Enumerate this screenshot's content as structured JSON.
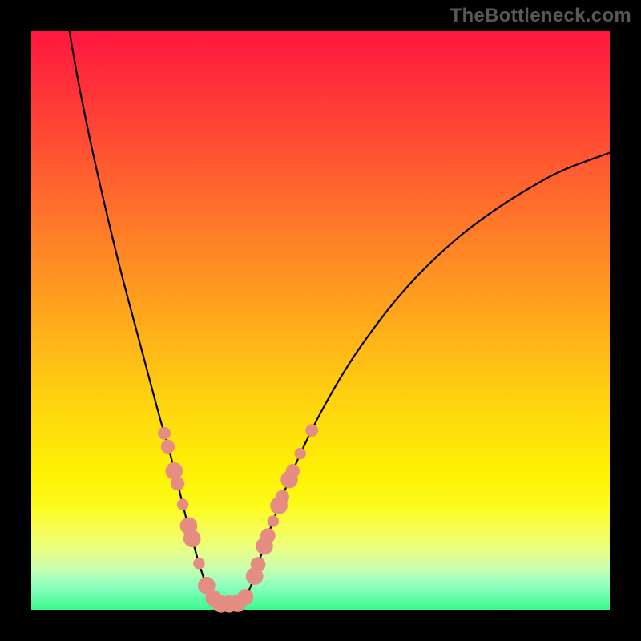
{
  "watermark": "TheBottleneck.com",
  "chart_data": {
    "type": "line",
    "title": "",
    "xlabel": "",
    "ylabel": "",
    "xlim": [
      0,
      100
    ],
    "ylim": [
      0,
      100
    ],
    "grid": false,
    "legend": false,
    "curve": [
      {
        "x": 6.6,
        "y": 100.0
      },
      {
        "x": 8.0,
        "y": 92.0
      },
      {
        "x": 10.0,
        "y": 82.0
      },
      {
        "x": 12.0,
        "y": 73.0
      },
      {
        "x": 14.0,
        "y": 64.5
      },
      {
        "x": 16.0,
        "y": 56.5
      },
      {
        "x": 18.0,
        "y": 49.0
      },
      {
        "x": 20.0,
        "y": 41.5
      },
      {
        "x": 22.0,
        "y": 34.0
      },
      {
        "x": 23.0,
        "y": 30.5
      },
      {
        "x": 24.0,
        "y": 27.0
      },
      {
        "x": 25.0,
        "y": 23.0
      },
      {
        "x": 26.0,
        "y": 19.0
      },
      {
        "x": 27.0,
        "y": 15.0
      },
      {
        "x": 28.0,
        "y": 11.5
      },
      {
        "x": 29.0,
        "y": 8.0
      },
      {
        "x": 30.0,
        "y": 5.0
      },
      {
        "x": 31.0,
        "y": 3.0
      },
      {
        "x": 32.0,
        "y": 1.5
      },
      {
        "x": 33.0,
        "y": 1.0
      },
      {
        "x": 34.0,
        "y": 1.0
      },
      {
        "x": 35.0,
        "y": 1.0
      },
      {
        "x": 36.0,
        "y": 1.2
      },
      {
        "x": 37.0,
        "y": 2.2
      },
      {
        "x": 38.0,
        "y": 4.2
      },
      {
        "x": 39.0,
        "y": 7.2
      },
      {
        "x": 40.0,
        "y": 10.2
      },
      {
        "x": 41.5,
        "y": 14.5
      },
      {
        "x": 43.0,
        "y": 18.5
      },
      {
        "x": 45.0,
        "y": 23.5
      },
      {
        "x": 47.0,
        "y": 28.0
      },
      {
        "x": 50.0,
        "y": 34.0
      },
      {
        "x": 54.0,
        "y": 41.0
      },
      {
        "x": 58.0,
        "y": 47.0
      },
      {
        "x": 63.0,
        "y": 53.5
      },
      {
        "x": 68.0,
        "y": 59.0
      },
      {
        "x": 74.0,
        "y": 64.5
      },
      {
        "x": 80.0,
        "y": 69.0
      },
      {
        "x": 86.0,
        "y": 72.8
      },
      {
        "x": 92.0,
        "y": 76.0
      },
      {
        "x": 100.0,
        "y": 79.0
      }
    ],
    "markers": [
      {
        "x": 23.0,
        "y": 30.5,
        "r": 1.1
      },
      {
        "x": 23.6,
        "y": 28.2,
        "r": 1.2
      },
      {
        "x": 24.7,
        "y": 24.0,
        "r": 1.5
      },
      {
        "x": 25.3,
        "y": 21.8,
        "r": 1.2
      },
      {
        "x": 26.2,
        "y": 18.2,
        "r": 1.0
      },
      {
        "x": 27.2,
        "y": 14.5,
        "r": 1.5
      },
      {
        "x": 27.8,
        "y": 12.3,
        "r": 1.5
      },
      {
        "x": 29.0,
        "y": 8.0,
        "r": 1.0
      },
      {
        "x": 30.3,
        "y": 4.2,
        "r": 1.5
      },
      {
        "x": 31.5,
        "y": 2.0,
        "r": 1.4
      },
      {
        "x": 32.8,
        "y": 1.0,
        "r": 1.5
      },
      {
        "x": 34.2,
        "y": 1.0,
        "r": 1.5
      },
      {
        "x": 35.6,
        "y": 1.1,
        "r": 1.5
      },
      {
        "x": 37.0,
        "y": 2.2,
        "r": 1.4
      },
      {
        "x": 38.6,
        "y": 5.8,
        "r": 1.5
      },
      {
        "x": 39.2,
        "y": 7.8,
        "r": 1.3
      },
      {
        "x": 40.3,
        "y": 11.0,
        "r": 1.5
      },
      {
        "x": 40.9,
        "y": 12.8,
        "r": 1.3
      },
      {
        "x": 41.8,
        "y": 15.3,
        "r": 1.0
      },
      {
        "x": 42.8,
        "y": 18.0,
        "r": 1.5
      },
      {
        "x": 43.4,
        "y": 19.5,
        "r": 1.2
      },
      {
        "x": 44.6,
        "y": 22.5,
        "r": 1.5
      },
      {
        "x": 45.2,
        "y": 24.0,
        "r": 1.2
      },
      {
        "x": 46.5,
        "y": 27.0,
        "r": 1.0
      },
      {
        "x": 48.5,
        "y": 31.0,
        "r": 1.1
      }
    ]
  },
  "colors": {
    "curve": "#000000",
    "marker": "#e58d82",
    "frame": "#000000"
  }
}
